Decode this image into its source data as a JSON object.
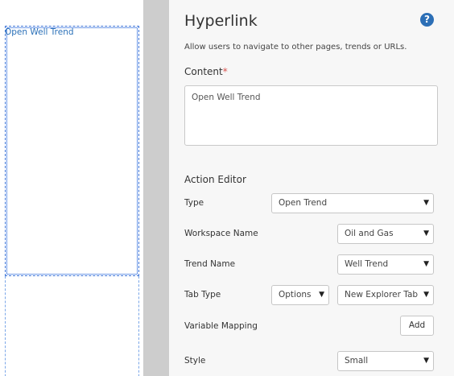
{
  "canvas": {
    "widget_link_text": "Open Well Trend"
  },
  "panel": {
    "title": "Hyperlink",
    "help_symbol": "?",
    "description": "Allow users to navigate to other pages, trends or URLs.",
    "content_label": "Content",
    "content_required_mark": "*",
    "content_value": "Open Well Trend",
    "action_editor_title": "Action Editor",
    "type": {
      "label": "Type",
      "value": "Open Trend"
    },
    "workspace": {
      "label": "Workspace Name",
      "value": "Oil and Gas"
    },
    "trend": {
      "label": "Trend Name",
      "value": "Well Trend"
    },
    "tab_type": {
      "label": "Tab Type",
      "option_value": "Options",
      "value": "New Explorer Tab"
    },
    "variable_mapping": {
      "label": "Variable Mapping",
      "button": "Add"
    },
    "style": {
      "label": "Style",
      "value": "Small"
    },
    "caret": "▼"
  },
  "colors": {
    "accent": "#2c6fb6",
    "selection": "#3b73d8",
    "required": "#d9534f"
  }
}
